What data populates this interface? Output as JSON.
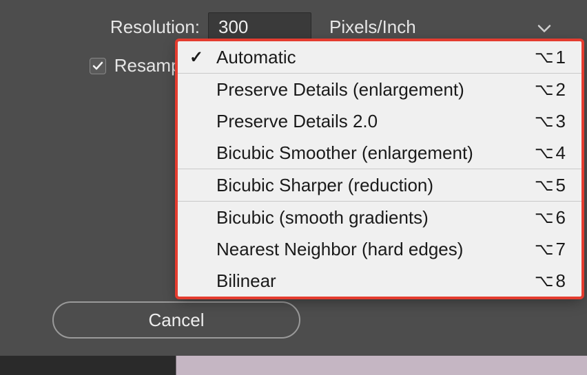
{
  "resolution": {
    "label": "Resolution:",
    "value": "300",
    "unit": "Pixels/Inch"
  },
  "resample": {
    "label": "Resample:",
    "checked": true
  },
  "menu": {
    "groups": [
      [
        {
          "label": "Automatic",
          "shortcut": "1",
          "checked": true
        }
      ],
      [
        {
          "label": "Preserve Details (enlargement)",
          "shortcut": "2",
          "checked": false
        },
        {
          "label": "Preserve Details 2.0",
          "shortcut": "3",
          "checked": false
        },
        {
          "label": "Bicubic Smoother (enlargement)",
          "shortcut": "4",
          "checked": false
        }
      ],
      [
        {
          "label": "Bicubic Sharper (reduction)",
          "shortcut": "5",
          "checked": false
        }
      ],
      [
        {
          "label": "Bicubic (smooth gradients)",
          "shortcut": "6",
          "checked": false
        },
        {
          "label": "Nearest Neighbor (hard edges)",
          "shortcut": "7",
          "checked": false
        },
        {
          "label": "Bilinear",
          "shortcut": "8",
          "checked": false
        }
      ]
    ]
  },
  "buttons": {
    "cancel": "Cancel"
  }
}
